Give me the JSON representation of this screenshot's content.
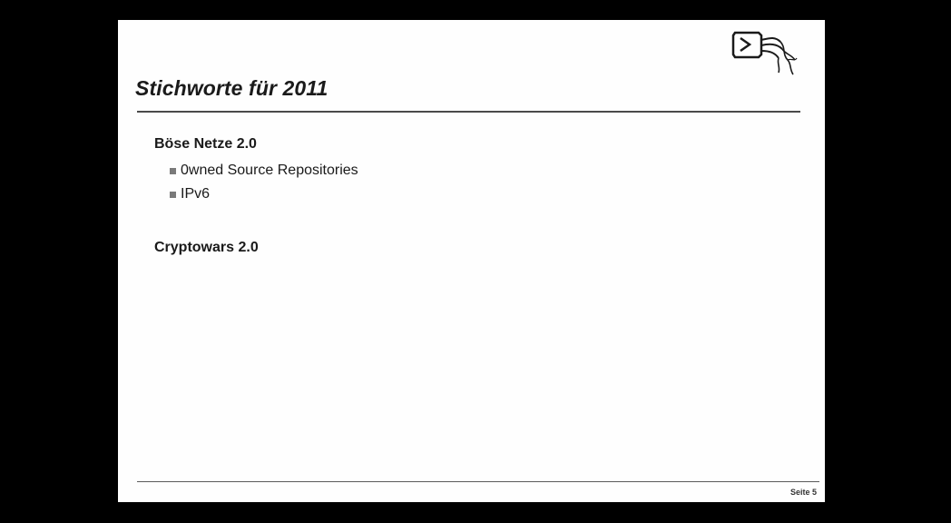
{
  "slide": {
    "title": "Stichworte für 2011",
    "sections": [
      {
        "heading": "Böse Netze 2.0",
        "bullets": [
          "0wned Source Repositories",
          "IPv6"
        ]
      },
      {
        "heading": "Cryptowars 2.0",
        "bullets": []
      }
    ],
    "footer": "Seite 5",
    "logo_icon": "chaos-computer-club-logo-icon",
    "colors": {
      "background": "#000000",
      "slide": "#fefefe",
      "text": "#1a1a1a",
      "rule": "#4a4a4a",
      "bullet": "#7a7a7a"
    }
  }
}
